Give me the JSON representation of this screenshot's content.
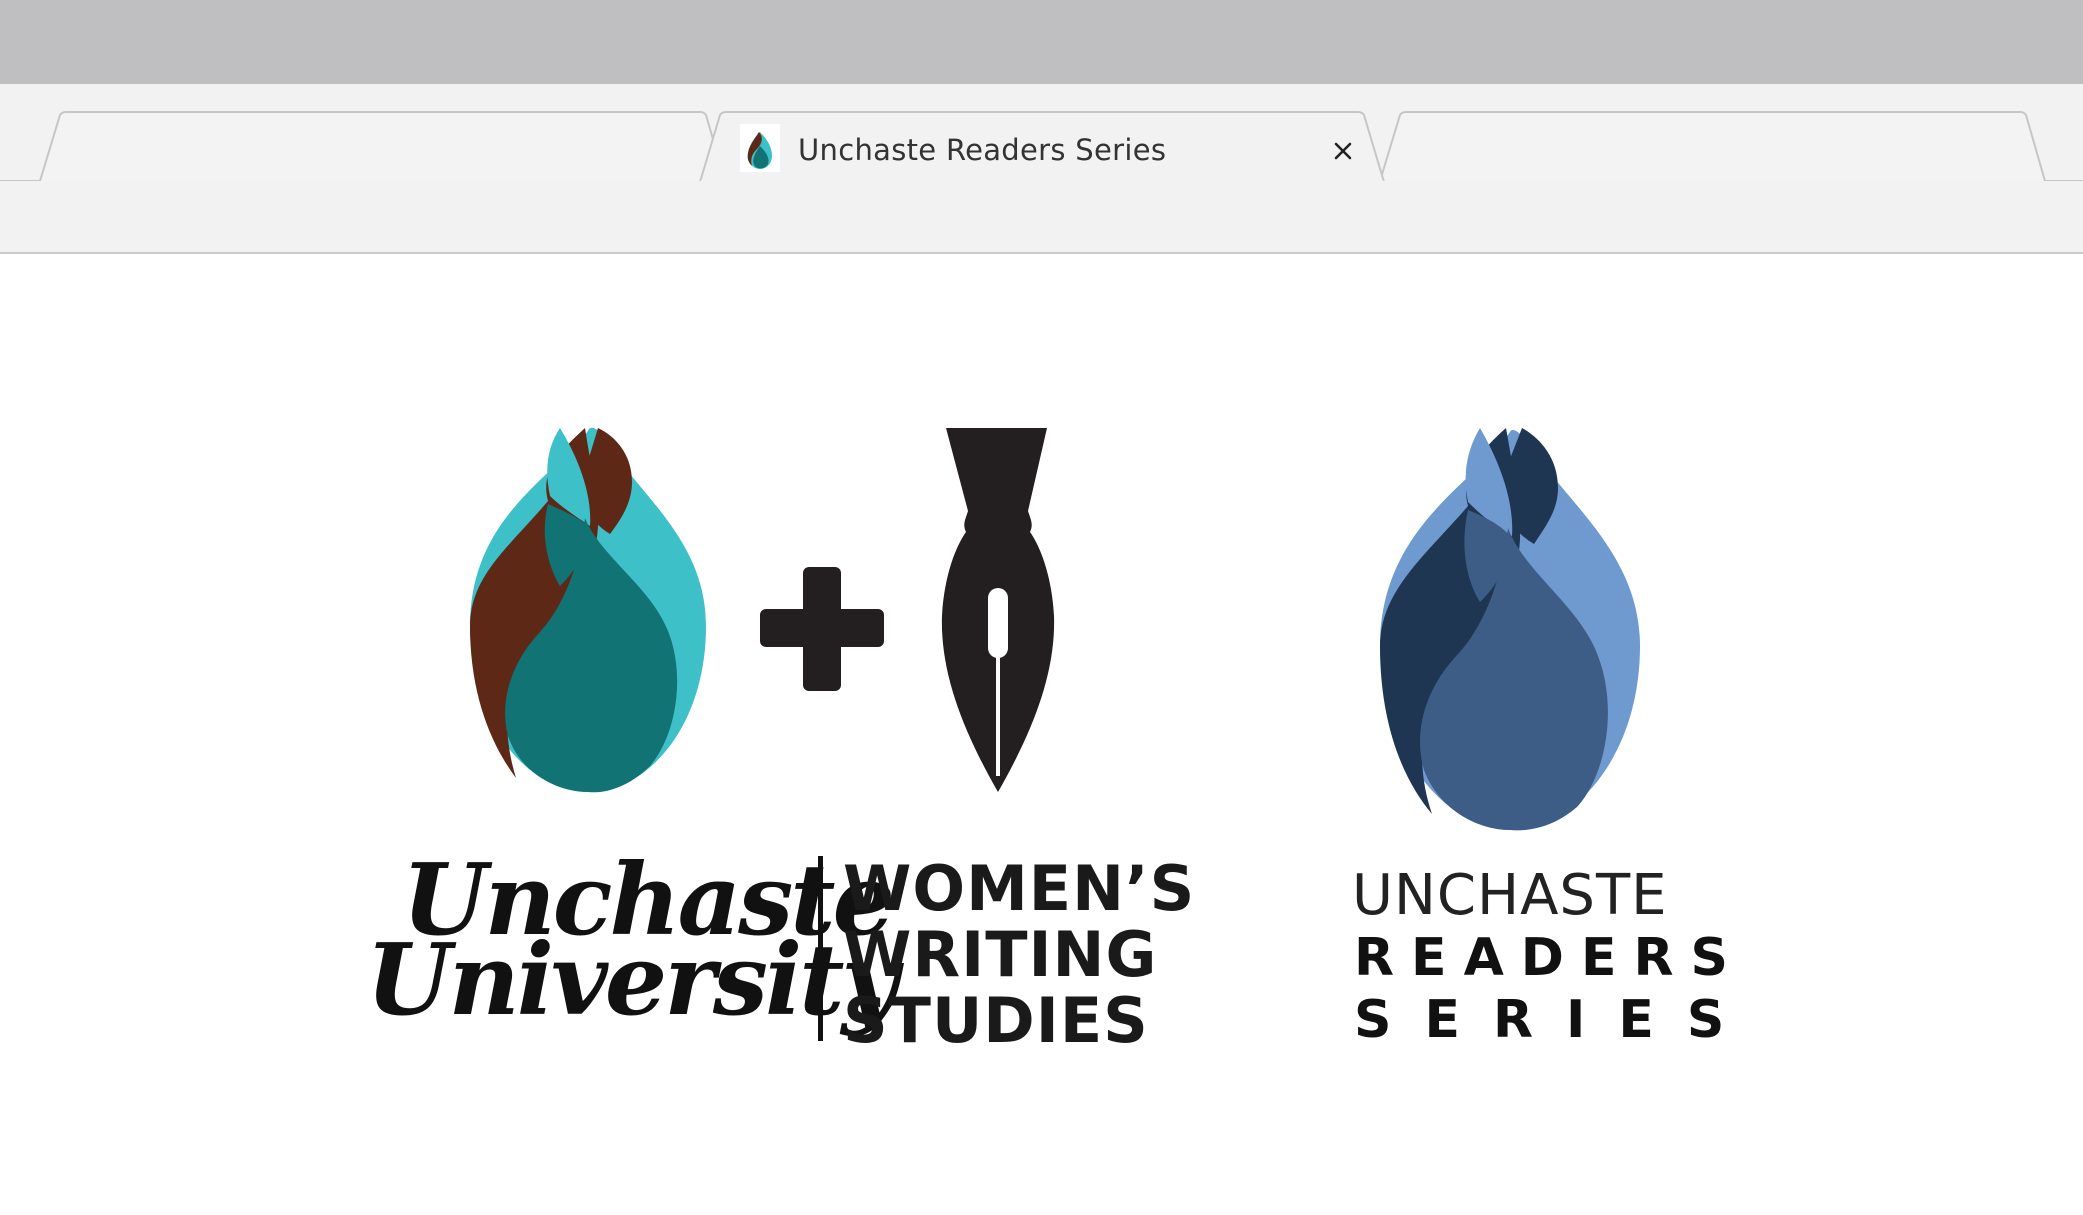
{
  "browser": {
    "tabs": [
      {
        "title": "",
        "active": false
      },
      {
        "title": "Unchaste Readers Series",
        "active": true,
        "favicon": "flame-logo-icon"
      },
      {
        "title": "",
        "active": false
      }
    ],
    "close_icon": "close-icon"
  },
  "content": {
    "left_logo": {
      "wordmark_line1": "Unchaste",
      "wordmark_line2": "University",
      "program_line1": "WOMEN’S",
      "program_line2": "WRITING",
      "program_line3": "STUDIES",
      "icons": [
        "flame-logo-icon",
        "plus-icon",
        "pen-nib-icon"
      ],
      "colors": {
        "brown": "#5e2817",
        "teal": "#3dc0c7",
        "dark_teal": "#127375",
        "ink": "#231f20"
      }
    },
    "right_logo": {
      "line1": "UNCHASTE",
      "line2": "READERS",
      "line3": "SERIES",
      "icons": [
        "flame-logo-icon"
      ],
      "colors": {
        "navy": "#1f3652",
        "light_blue": "#6e9ad0",
        "mid_blue": "#3e5d86"
      }
    }
  }
}
